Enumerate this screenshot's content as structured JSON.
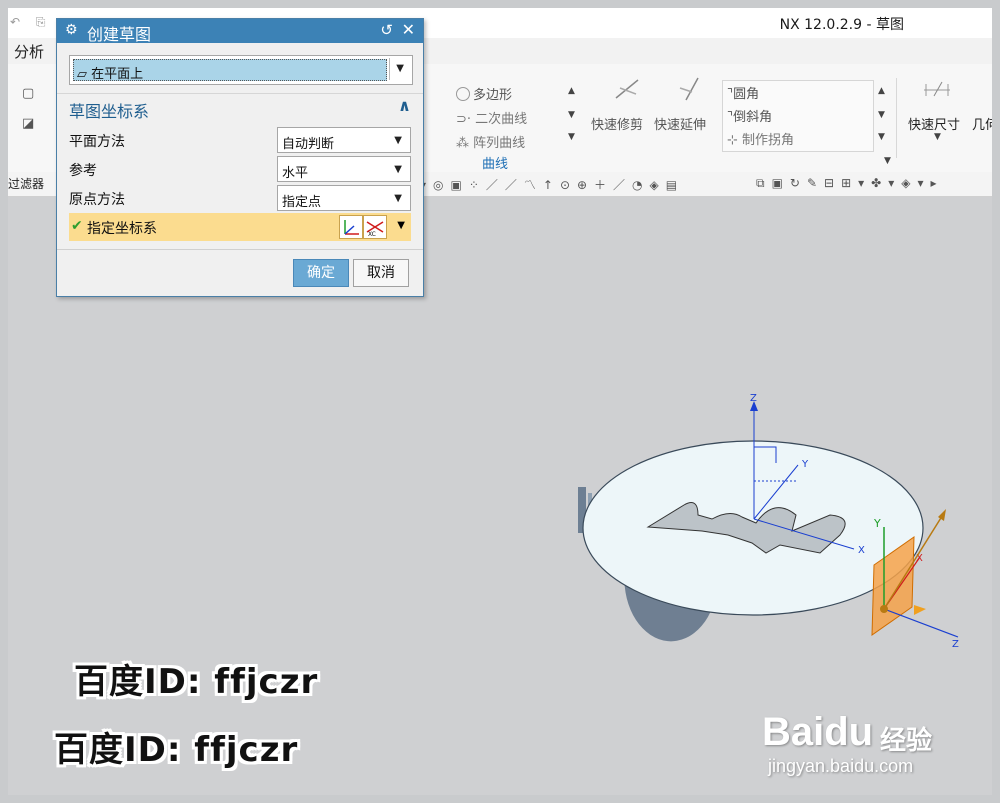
{
  "window": {
    "title": "NX 12.0.2.9 - 草图"
  },
  "menu": {
    "analysis": "分析"
  },
  "ribbon": {
    "curve_group": {
      "label": "曲线",
      "items": [
        "多边形",
        "二次曲线",
        "阵列曲线"
      ]
    },
    "trim": [
      "快速修剪",
      "快速延伸"
    ],
    "corner": [
      "圆角",
      "倒斜角",
      "制作拐角"
    ],
    "dimension": "快速尺寸",
    "geometry_partial": "几何"
  },
  "toolbar": {
    "filter_label": "过滤器"
  },
  "dialog": {
    "title": "创建草图",
    "type_value": "在平面上",
    "section_title": "草图坐标系",
    "rows": [
      {
        "label": "平面方法",
        "value": "自动判断"
      },
      {
        "label": "参考",
        "value": "水平"
      },
      {
        "label": "原点方法",
        "value": "指定点"
      }
    ],
    "specify_csys": "指定坐标系",
    "ok": "确定",
    "cancel": "取消"
  },
  "axes": {
    "x": "X",
    "y": "Y",
    "z": "Z"
  },
  "watermark": {
    "line1": "百度ID: ffjczr",
    "line2": "百度ID: ffjczr"
  },
  "baidu": {
    "logo": "Baidu",
    "jingyan": "经验",
    "url": "jingyan.baidu.com"
  },
  "colors": {
    "dialog_title": "#3c82b6",
    "accent": "#1e6fb5",
    "highlight": "#fbdc8f",
    "plane": "#f28c1a"
  }
}
